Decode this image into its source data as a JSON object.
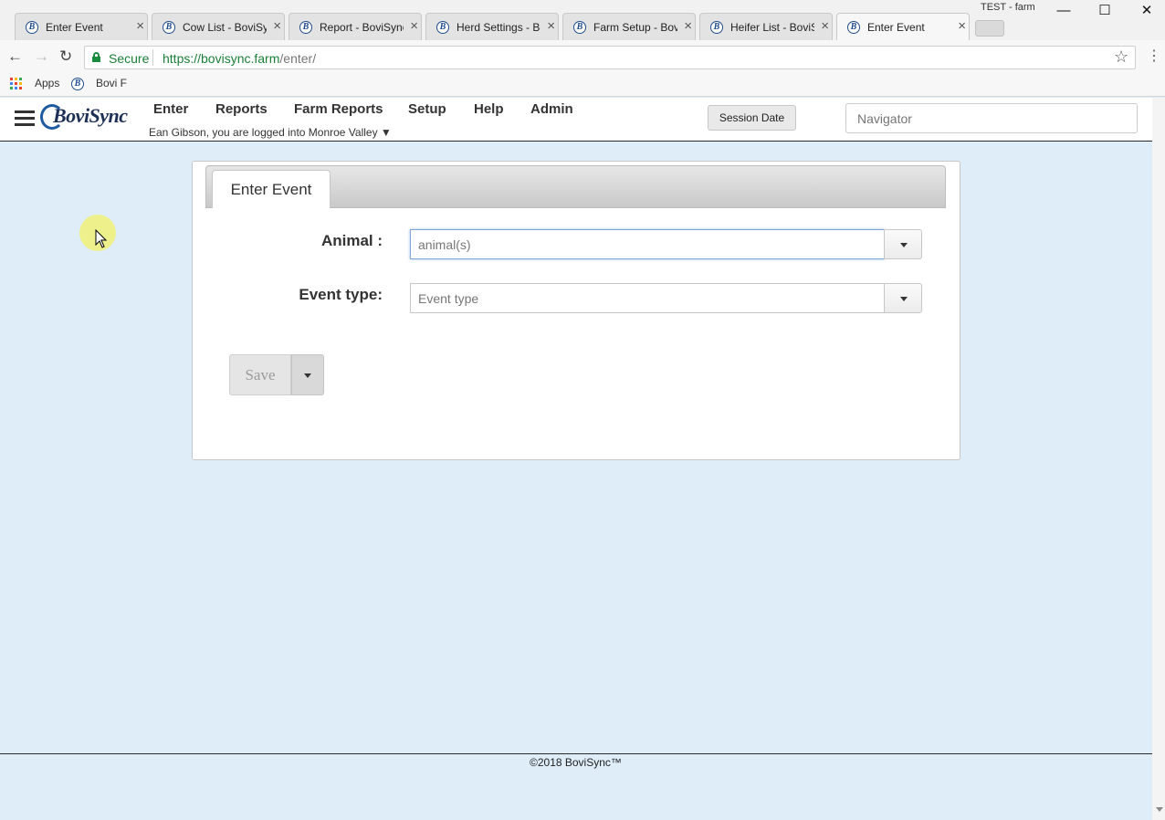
{
  "browser": {
    "tabs": [
      {
        "title": "Enter Event",
        "close": "×"
      },
      {
        "title": "Cow List - BoviSync",
        "close": "×"
      },
      {
        "title": "Report - BoviSync",
        "close": "×"
      },
      {
        "title": "Herd Settings - BoviSync",
        "close": "×"
      },
      {
        "title": "Farm Setup - BoviSync",
        "close": "×"
      },
      {
        "title": "Heifer List - BoviSync",
        "close": "×"
      },
      {
        "title": "Enter Event",
        "close": "×"
      }
    ],
    "favicon_letter": "B",
    "profile_name": "TEST - farm",
    "window_controls": {
      "minimize": "—",
      "maximize": "☐",
      "close": "✕"
    },
    "nav": {
      "back": "←",
      "forward": "→",
      "reload": "↻"
    },
    "secure_label": "Secure",
    "url_host": "https://bovisync.farm",
    "url_path": "/enter/",
    "star": "☆",
    "menu": "⋮",
    "bookmarks": [
      {
        "label": "Apps"
      },
      {
        "label": "Bovi F"
      }
    ]
  },
  "app": {
    "logo_text": "BoviSync",
    "nav": [
      "Enter",
      "Reports",
      "Farm Reports",
      "Setup",
      "Help",
      "Admin"
    ],
    "login_text": "Ean Gibson, you are logged into Monroe Valley ▼",
    "session_button": "Session Date",
    "navigator_placeholder": "Navigator"
  },
  "form": {
    "tab_title": "Enter Event",
    "animal_label": "Animal :",
    "animal_placeholder": "animal(s)",
    "animal_value": "",
    "event_label": "Event type:",
    "event_placeholder": "Event type",
    "event_value": "",
    "save_label": "Save"
  },
  "footer": {
    "copyright": "©2018 BoviSync™"
  },
  "colors": {
    "page_background": "#dfedf9",
    "secure_green": "#1a7f37",
    "logo_blue": "#1f5ba3"
  }
}
